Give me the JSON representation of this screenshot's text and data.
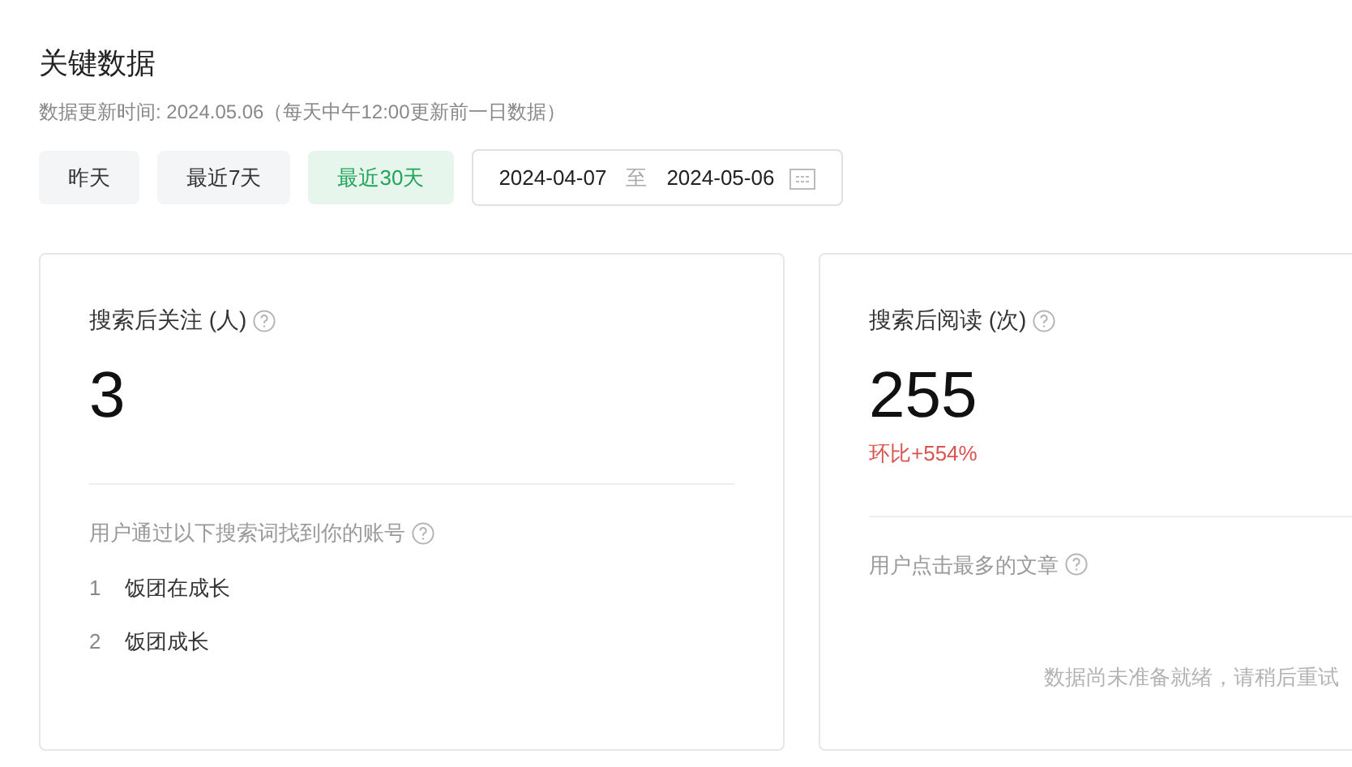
{
  "title": "关键数据",
  "update_note": "数据更新时间: 2024.05.06（每天中午12:00更新前一日数据）",
  "ranges": [
    {
      "label": "昨天",
      "selected": false
    },
    {
      "label": "最近7天",
      "selected": false
    },
    {
      "label": "最近30天",
      "selected": true
    }
  ],
  "date_range": {
    "start": "2024-04-07",
    "separator": "至",
    "end": "2024-05-06"
  },
  "cards": [
    {
      "metric_label": "搜索后关注 (人)",
      "value": "3",
      "section_label": "用户通过以下搜索词找到你的账号",
      "items": [
        {
          "rank": "1",
          "text": "饭团在成长"
        },
        {
          "rank": "2",
          "text": "饭团成长"
        }
      ]
    },
    {
      "metric_label": "搜索后阅读 (次)",
      "value": "255",
      "change": "环比+554%",
      "section_label": "用户点击最多的文章",
      "empty_message": "数据尚未准备就绪，请稍后重试"
    }
  ]
}
